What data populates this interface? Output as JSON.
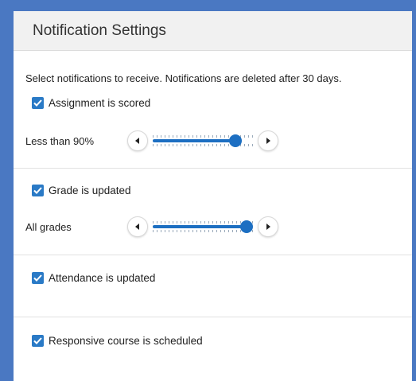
{
  "header": {
    "title": "Notification Settings"
  },
  "intro": "Select notifications to receive. Notifications are deleted after 30 days.",
  "items": [
    {
      "label": "Assignment is scored",
      "checked": true,
      "slider": {
        "label": "Less than 90%",
        "value_fraction": 0.88
      }
    },
    {
      "label": "Grade is updated",
      "checked": true,
      "slider": {
        "label": "All grades",
        "value_fraction": 1.0
      }
    },
    {
      "label": "Attendance is updated",
      "checked": true
    },
    {
      "label": "Responsive course is scheduled",
      "checked": true
    }
  ],
  "icons": {
    "checkbox": "check-icon",
    "left": "arrow-left-icon",
    "right": "arrow-right-icon"
  },
  "colors": {
    "accent": "#1d6fc2",
    "checkbox": "#2a7ac6",
    "frame": "#4a78c2"
  }
}
